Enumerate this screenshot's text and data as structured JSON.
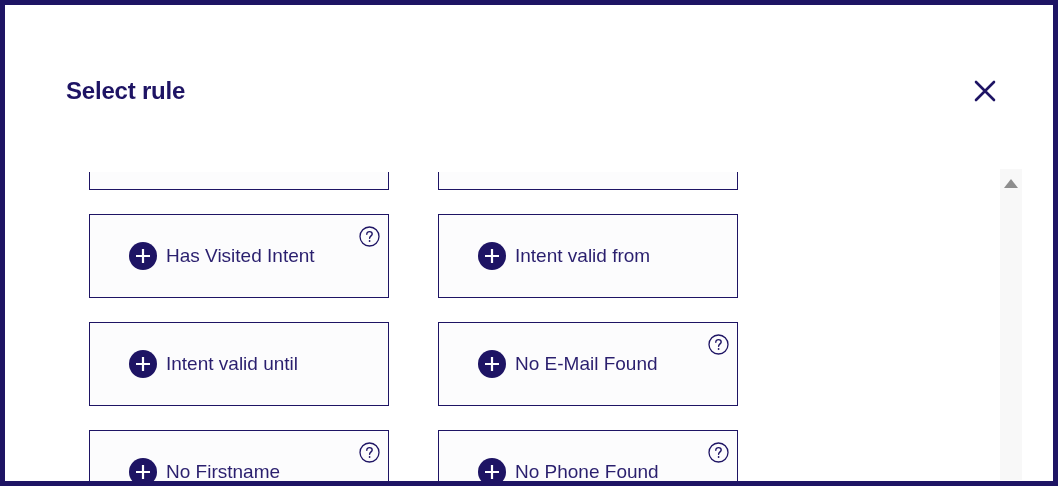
{
  "dialog": {
    "title": "Select rule"
  },
  "rules": [
    {
      "kind": "clipped"
    },
    {
      "kind": "clipped"
    },
    {
      "kind": "rule",
      "label": "Has Visited Intent",
      "help": true
    },
    {
      "kind": "rule",
      "label": "Intent valid from",
      "help": false
    },
    {
      "kind": "rule",
      "label": "Intent valid until",
      "help": false
    },
    {
      "kind": "rule",
      "label": "No E-Mail Found",
      "help": true
    },
    {
      "kind": "rule",
      "label": "No Firstname",
      "help": true
    },
    {
      "kind": "rule",
      "label": "No Phone Found",
      "help": true
    }
  ]
}
